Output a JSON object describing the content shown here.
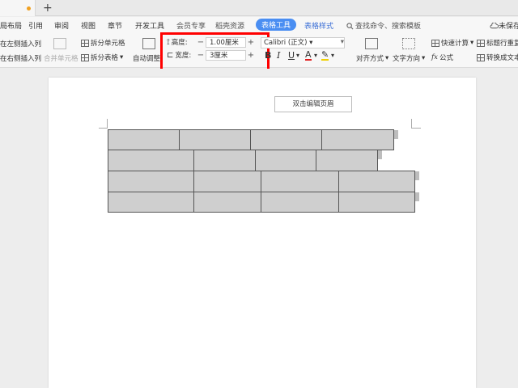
{
  "menu": {
    "items": [
      "局布局",
      "引用",
      "审阅",
      "视图",
      "章节",
      "开发工具",
      "会员专享",
      "稻壳资源",
      "表格工具",
      "表格样式"
    ],
    "search": "查找命令、搜索模板"
  },
  "ribbon": {
    "insert_left": "在左侧插入列",
    "insert_right": "在右侧插入列",
    "merge": "合并单元格",
    "split_cell": "拆分单元格",
    "split_table": "拆分表格",
    "auto_fit": "自动调整",
    "height_label": "高度:",
    "height_value": "1.00厘米",
    "width_label": "宽度:",
    "width_value": "3厘米",
    "font_name": "Calibri (正文)",
    "align": "对齐方式",
    "text_dir": "文字方向",
    "formula": "公式",
    "quick_calc": "快速计算",
    "title_repeat": "标题行重复",
    "to_text": "转换成文本",
    "cloud": "未保存"
  },
  "document": {
    "header_hint": "双击编辑页眉"
  }
}
